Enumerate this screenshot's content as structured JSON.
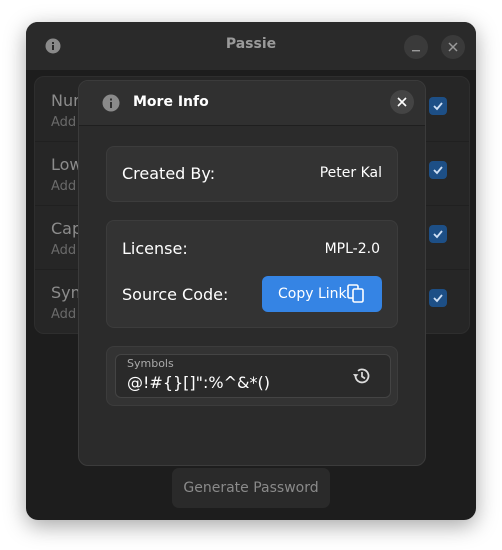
{
  "window": {
    "title": "Passie"
  },
  "background_rows": [
    {
      "title": "Nur",
      "subtitle": "Add"
    },
    {
      "title": "Low",
      "subtitle": "Add"
    },
    {
      "title": "Cap",
      "subtitle": "Add"
    },
    {
      "title": "Sym",
      "subtitle": "Add"
    }
  ],
  "generate_button": "Generate Password",
  "dialog": {
    "title": "More Info",
    "created_by": {
      "label": "Created By:",
      "value": "Peter Kal"
    },
    "license": {
      "label": "License:",
      "value": "MPL-2.0"
    },
    "source_code": {
      "label": "Source Code:",
      "button": "Copy Link"
    },
    "symbols": {
      "label": "Symbols",
      "value": "@!#{}[]\":%^&*()"
    }
  },
  "colors": {
    "accent": "#3584e4",
    "window_bg": "#1d1d1d",
    "dialog_bg": "#2b2b2b",
    "card_bg": "#333333"
  },
  "icons": [
    "info-icon",
    "minimize-icon",
    "close-icon",
    "checkmark-icon",
    "copy-icon",
    "reset-history-icon"
  ]
}
